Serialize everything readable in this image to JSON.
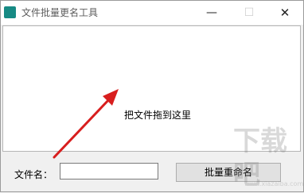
{
  "window": {
    "title": "文件批量更名工具",
    "minimize_glyph": "—",
    "maximize_glyph": "☐",
    "close_glyph": "✕"
  },
  "drop_zone": {
    "hint": "把文件拖到这里"
  },
  "form": {
    "filename_label": "文件名：",
    "filename_value": "",
    "rename_button": "批量重命名"
  },
  "watermark": {
    "text": "下载吧",
    "sub": "www.xiazaiba.com"
  },
  "colors": {
    "arrow": "#d81e1e",
    "icon": "#178a84"
  },
  "icons": [
    "app-icon",
    "arrow-icon"
  ]
}
